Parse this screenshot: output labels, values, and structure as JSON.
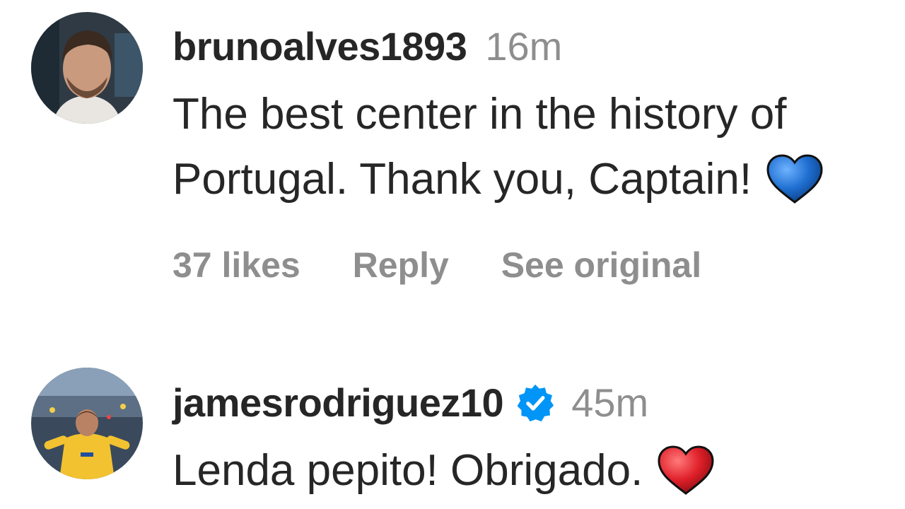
{
  "comments": [
    {
      "username": "brunoalves1893",
      "verified": false,
      "time": "16m",
      "text": "The best center in the history of Portugal. Thank you, Captain!",
      "emoji": "blue-heart",
      "likes": "37 likes",
      "reply_label": "Reply",
      "see_original_label": "See original"
    },
    {
      "username": "jamesrodriguez10",
      "verified": true,
      "time": "45m",
      "text": "Lenda pepito! Obrigado.",
      "emoji": "red-heart"
    }
  ],
  "colors": {
    "text": "#262626",
    "muted": "#8e8e8e",
    "verified": "#0095f6",
    "blue_heart": "#1f6fd1",
    "red_heart": "#e0202a"
  },
  "icons": {
    "verified": "verified-badge-icon",
    "blue_heart": "blue-heart-icon",
    "red_heart": "red-heart-icon"
  }
}
